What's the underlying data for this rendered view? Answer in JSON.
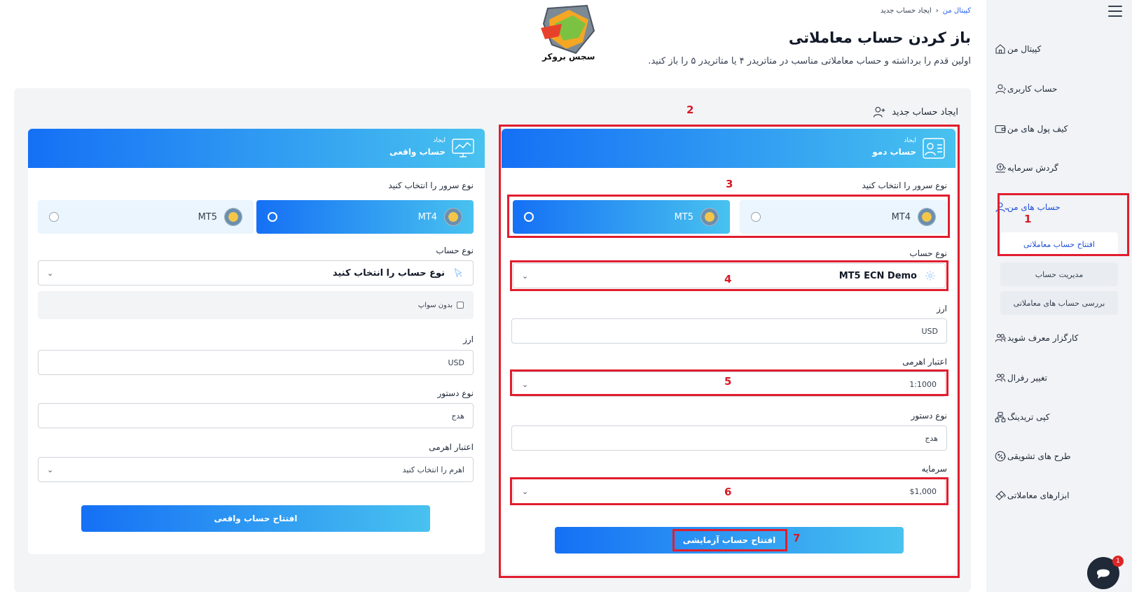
{
  "breadcrumb": {
    "home": "کپیتال من",
    "separator": "‹",
    "current": "ایجاد حساب جدید"
  },
  "header": {
    "title": "باز کردن حساب معاملاتی",
    "subtitle": "اولین قدم را برداشته و حساب معاملاتی مناسب در متاتریدر ۴ یا متاتریدر ۵ را باز کنید.",
    "logo_text": "سجس بروکر"
  },
  "sidebar": {
    "items": [
      {
        "label": "کپیتال من",
        "icon": "home-icon"
      },
      {
        "label": "حساب کاربری",
        "icon": "user-icon"
      },
      {
        "label": "کیف پول های من",
        "icon": "wallet-icon"
      },
      {
        "label": "گردش سرمایه",
        "icon": "money-flow-icon"
      },
      {
        "label": "حساب های من",
        "icon": "user-icon"
      },
      {
        "label": "کارگزار معرف شوید",
        "icon": "users-icon"
      },
      {
        "label": "تغییر رفرال",
        "icon": "users-icon"
      },
      {
        "label": "کپی تریدینگ",
        "icon": "network-icon"
      },
      {
        "label": "طرح های تشویقی",
        "icon": "percent-badge-icon"
      },
      {
        "label": "ابزارهای معاملاتی",
        "icon": "tools-icon"
      }
    ],
    "sub_items": [
      {
        "label": "افتتاح حساب معاملاتی"
      },
      {
        "label": "مدیریت حساب"
      },
      {
        "label": "بررسی حساب های معاملاتی"
      }
    ]
  },
  "section": {
    "title": "ایجاد حساب جدید"
  },
  "demo_card": {
    "head_small": "ایجاد",
    "head_big": "حساب دمو",
    "server_label": "نوع سرور را انتخاب کنید",
    "server_options": [
      "MT4",
      "MT5"
    ],
    "selected_server": "MT5",
    "account_type_label": "نوع حساب",
    "account_type_value": "MT5 ECN Demo",
    "currency_label": "ارز",
    "currency_value": "USD",
    "leverage_label": "اعتبار اهرمی",
    "leverage_value": "1:1000",
    "order_type_label": "نوع دستور",
    "order_type_value": "هدج",
    "capital_label": "سرمایه",
    "capital_value": "$1,000",
    "submit_label": "افتتاح حساب آزمایشی"
  },
  "real_card": {
    "head_small": "ایجاد",
    "head_big": "حساب واقعی",
    "server_label": "نوع سرور را انتخاب کنید",
    "server_options": [
      "MT4",
      "MT5"
    ],
    "selected_server": "MT4",
    "account_type_label": "نوع حساب",
    "account_type_placeholder": "نوع حساب را انتخاب کنید",
    "swap_label": "بدون سواپ",
    "currency_label": "ارز",
    "currency_value": "USD",
    "order_type_label": "نوع دستور",
    "order_type_value": "هدج",
    "leverage_label": "اعتبار اهرمی",
    "leverage_placeholder": "اهرم را انتخاب کنید",
    "submit_label": "افتتاح حساب واقعی"
  },
  "annotations": [
    "1",
    "2",
    "3",
    "4",
    "5",
    "6",
    "7"
  ],
  "chat": {
    "badge": "1"
  },
  "colors": {
    "accent_start": "#1570f5",
    "accent_end": "#48c2ef",
    "annotation": "#e11d2e",
    "active_nav": "#1d4ed8"
  }
}
